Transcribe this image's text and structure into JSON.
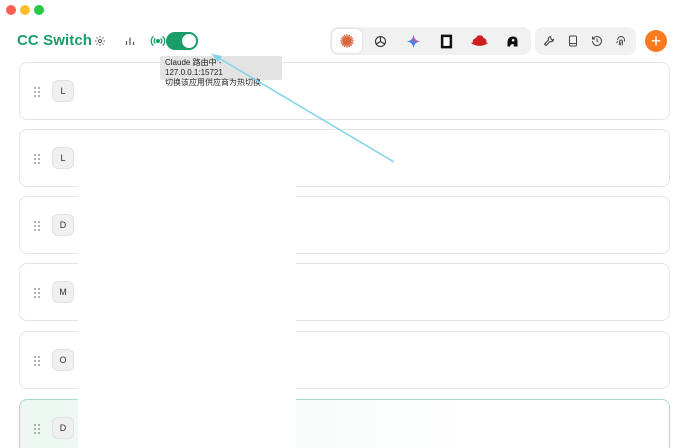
{
  "app": {
    "title": "CC Switch"
  },
  "header": {
    "settings_icon": "gear-icon",
    "stats_icon": "bar-chart-icon",
    "proxy_icon": "broadcast-icon",
    "proxy_enabled": true
  },
  "tooltip": {
    "line1": "Claude 路由中 - 127.0.0.1:15721",
    "line2": "切换该应用供应商为热切换"
  },
  "app_switcher": {
    "items": [
      {
        "name": "claude-app-icon",
        "active": true,
        "color": "#d9673f"
      },
      {
        "name": "openai-app-icon",
        "active": false,
        "color": "#333333"
      },
      {
        "name": "gemini-app-icon",
        "active": false,
        "color": "#4a7bff"
      },
      {
        "name": "opencode-app-icon",
        "active": false,
        "color": "#111111"
      },
      {
        "name": "redhat-app-icon",
        "active": false,
        "color": "#cc1f1f"
      },
      {
        "name": "assistant-app-icon",
        "active": false,
        "color": "#111111"
      }
    ]
  },
  "tools": {
    "items": [
      "wrench-icon",
      "book-icon",
      "history-icon",
      "fingerprint-icon"
    ]
  },
  "add_button": {
    "label": "+",
    "color": "#f97b1d"
  },
  "providers": [
    {
      "badge": "L",
      "active": false
    },
    {
      "badge": "L",
      "active": false
    },
    {
      "badge": "D",
      "active": false
    },
    {
      "badge": "M",
      "active": false
    },
    {
      "badge": "O",
      "active": false
    },
    {
      "badge": "D",
      "active": true
    }
  ],
  "colors": {
    "brand": "#1a9d68",
    "accent": "#f97b1d",
    "arrow": "#7fd4ea"
  }
}
